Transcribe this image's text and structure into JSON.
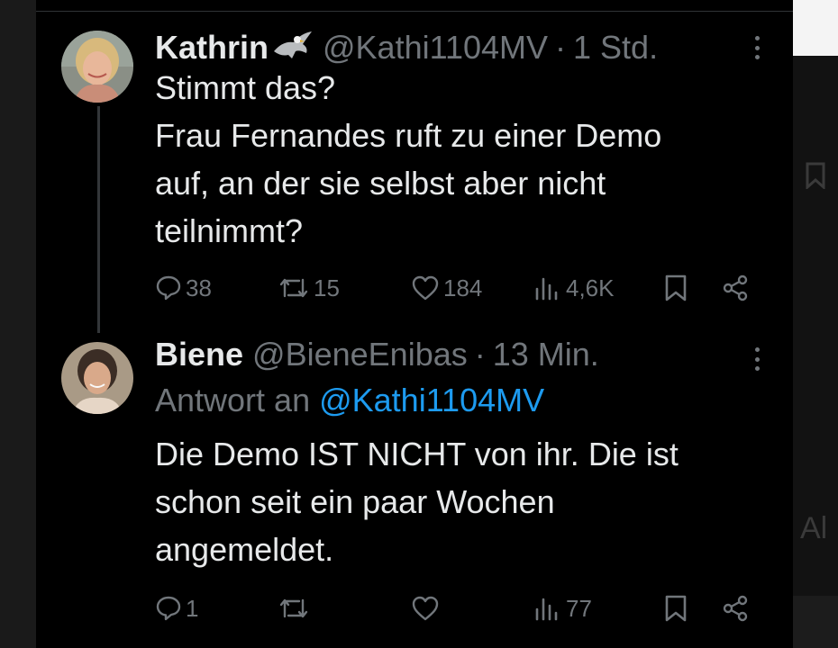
{
  "tweets": [
    {
      "display_name": "Kathrin",
      "emoji": "eagle-emoji",
      "handle": "@Kathi1104MV",
      "separator": "·",
      "timestamp": "1 Std.",
      "text": "Stimmt das?\nFrau Fernandes ruft zu einer Demo\nauf, an der sie selbst aber nicht\nteilnimmt?",
      "actions": {
        "replies": "38",
        "retweets": "15",
        "likes": "184",
        "views": "4,6K"
      }
    },
    {
      "display_name": "Biene",
      "handle": "@BieneEnibas",
      "separator": "·",
      "timestamp": "13 Min.",
      "reply_prefix": "Antwort an ",
      "reply_mention": "@Kathi1104MV",
      "text": "Die Demo IST NICHT von ihr. Die ist\nschon seit ein paar Wochen\nangemeldet.",
      "actions": {
        "replies": "1",
        "retweets": "",
        "likes": "",
        "views": "77"
      }
    }
  ],
  "edge_text": "Al",
  "colors": {
    "background": "#000000",
    "text": "#e7e9ea",
    "muted": "#71767b",
    "link": "#1d9bf0",
    "thread_line": "#333639"
  }
}
